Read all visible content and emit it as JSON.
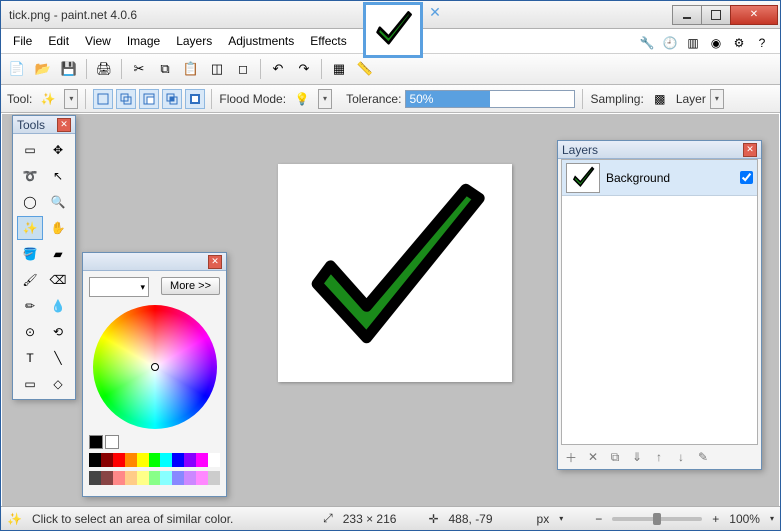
{
  "window": {
    "title": "tick.png - paint.net 4.0.6"
  },
  "menu": {
    "file": "File",
    "edit": "Edit",
    "view": "View",
    "image": "Image",
    "layers": "Layers",
    "adjustments": "Adjustments",
    "effects": "Effects"
  },
  "options": {
    "tool_label": "Tool:",
    "flood_label": "Flood Mode:",
    "tolerance_label": "Tolerance:",
    "tolerance_value": "50%",
    "sampling_label": "Sampling:",
    "sampling_value": "Layer"
  },
  "panels": {
    "tools_title": "Tools",
    "layers_title": "Layers",
    "colors_more": "More >>"
  },
  "layers": {
    "items": [
      {
        "name": "Background",
        "visible": true
      }
    ]
  },
  "status": {
    "hint": "Click to select an area of similar color.",
    "size": "233 × 216",
    "cursor": "488, -79",
    "unit": "px",
    "zoom": "100%"
  }
}
